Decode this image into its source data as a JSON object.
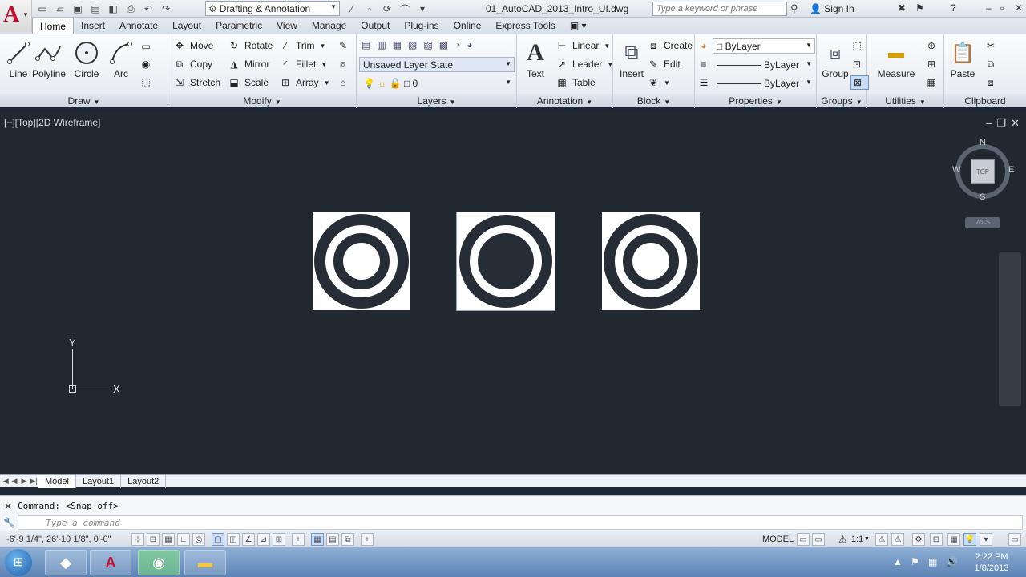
{
  "titlebar": {
    "workspace": "Drafting & Annotation",
    "document": "01_AutoCAD_2013_Intro_UI.dwg",
    "search_placeholder": "Type a keyword or phrase",
    "signin": "Sign In"
  },
  "tabs": [
    "Home",
    "Insert",
    "Annotate",
    "Layout",
    "Parametric",
    "View",
    "Manage",
    "Output",
    "Plug-ins",
    "Online",
    "Express Tools"
  ],
  "ribbon": {
    "draw": {
      "title": "Draw",
      "tools": [
        "Line",
        "Polyline",
        "Circle",
        "Arc"
      ]
    },
    "modify": {
      "title": "Modify",
      "row1": [
        "Move",
        "Rotate",
        "Trim"
      ],
      "row2": [
        "Copy",
        "Mirror",
        "Fillet"
      ],
      "row3": [
        "Stretch",
        "Scale",
        "Array"
      ]
    },
    "layers": {
      "title": "Layers",
      "layer_state": "Unsaved Layer State",
      "current_layer": "0"
    },
    "annotation": {
      "title": "Annotation",
      "text": "Text",
      "linear": "Linear",
      "leader": "Leader",
      "table": "Table"
    },
    "block": {
      "title": "Block",
      "insert": "Insert",
      "create": "Create",
      "edit": "Edit"
    },
    "properties": {
      "title": "Properties",
      "color": "ByLayer",
      "linetype": "ByLayer",
      "lineweight": "ByLayer"
    },
    "groups": {
      "title": "Groups",
      "group": "Group"
    },
    "utilities": {
      "title": "Utilities",
      "measure": "Measure"
    },
    "clipboard": {
      "title": "Clipboard",
      "paste": "Paste"
    }
  },
  "viewport": {
    "label": "[−][Top][2D Wireframe]",
    "viewcube": {
      "n": "N",
      "s": "S",
      "e": "E",
      "w": "W",
      "face": "TOP",
      "ucs": "WCS"
    },
    "ucs_x": "X",
    "ucs_y": "Y"
  },
  "layout_tabs": [
    "Model",
    "Layout1",
    "Layout2"
  ],
  "command": {
    "history": "Command:  <Snap off>",
    "placeholder": "Type a command"
  },
  "status": {
    "coords": "-6'-9 1/4\",  26'-10 1/8\", 0'-0\"",
    "model": "MODEL",
    "scale": "1:1"
  },
  "taskbar": {
    "time": "2:22 PM",
    "date": "1/8/2013"
  }
}
